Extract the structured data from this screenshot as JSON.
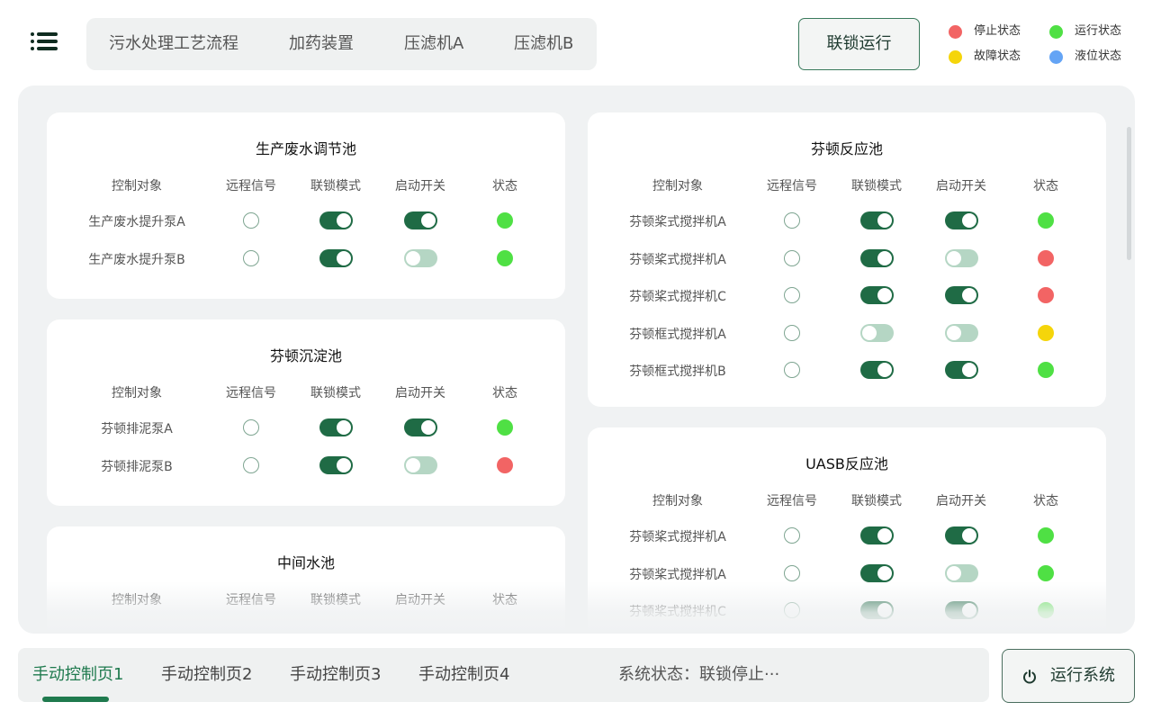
{
  "header": {
    "tabs": [
      {
        "label": "污水处理工艺流程"
      },
      {
        "label": "加药装置"
      },
      {
        "label": "压滤机A"
      },
      {
        "label": "压滤机B"
      }
    ],
    "interlock_button": "联锁运行",
    "legend": [
      {
        "label": "停止状态",
        "color": "#f26464"
      },
      {
        "label": "运行状态",
        "color": "#4fe044"
      },
      {
        "label": "故障状态",
        "color": "#f5d50a"
      },
      {
        "label": "液位状态",
        "color": "#64a4f5"
      }
    ]
  },
  "columns": [
    "控制对象",
    "远程信号",
    "联锁模式",
    "启动开关",
    "状态"
  ],
  "status_colors": {
    "stop": "#f26464",
    "run": "#4fe044",
    "fault": "#f5d50a",
    "level": "#64a4f5"
  },
  "cards": [
    {
      "title": "生产废水调节池",
      "rows": [
        {
          "name": "生产废水提升泵A",
          "interlock": true,
          "switch": true,
          "status": "run"
        },
        {
          "name": "生产废水提升泵B",
          "interlock": true,
          "switch": false,
          "status": "run"
        }
      ]
    },
    {
      "title": "芬顿沉淀池",
      "rows": [
        {
          "name": "芬顿排泥泵A",
          "interlock": true,
          "switch": true,
          "status": "run"
        },
        {
          "name": "芬顿排泥泵B",
          "interlock": true,
          "switch": false,
          "status": "stop"
        }
      ]
    },
    {
      "title": "中间水池",
      "rows": []
    },
    {
      "title": "芬顿反应池",
      "rows": [
        {
          "name": "芬顿桨式搅拌机A",
          "interlock": true,
          "switch": true,
          "status": "run"
        },
        {
          "name": "芬顿桨式搅拌机A",
          "interlock": true,
          "switch": false,
          "status": "stop"
        },
        {
          "name": "芬顿桨式搅拌机C",
          "interlock": true,
          "switch": true,
          "status": "stop"
        },
        {
          "name": "芬顿框式搅拌机A",
          "interlock": false,
          "switch": false,
          "status": "fault"
        },
        {
          "name": "芬顿框式搅拌机B",
          "interlock": true,
          "switch": true,
          "status": "run"
        }
      ]
    },
    {
      "title": "UASB反应池",
      "rows": [
        {
          "name": "芬顿桨式搅拌机A",
          "interlock": true,
          "switch": true,
          "status": "run"
        },
        {
          "name": "芬顿桨式搅拌机A",
          "interlock": true,
          "switch": false,
          "status": "run"
        },
        {
          "name": "芬顿桨式搅拌机C",
          "interlock": true,
          "switch": true,
          "status": "run"
        }
      ]
    }
  ],
  "footer": {
    "tabs": [
      {
        "label": "手动控制页1"
      },
      {
        "label": "手动控制页2"
      },
      {
        "label": "手动控制页3"
      },
      {
        "label": "手动控制页4"
      }
    ],
    "active_tab": 0,
    "system_status": "系统状态：联锁停止···",
    "run_button": "运行系统"
  }
}
